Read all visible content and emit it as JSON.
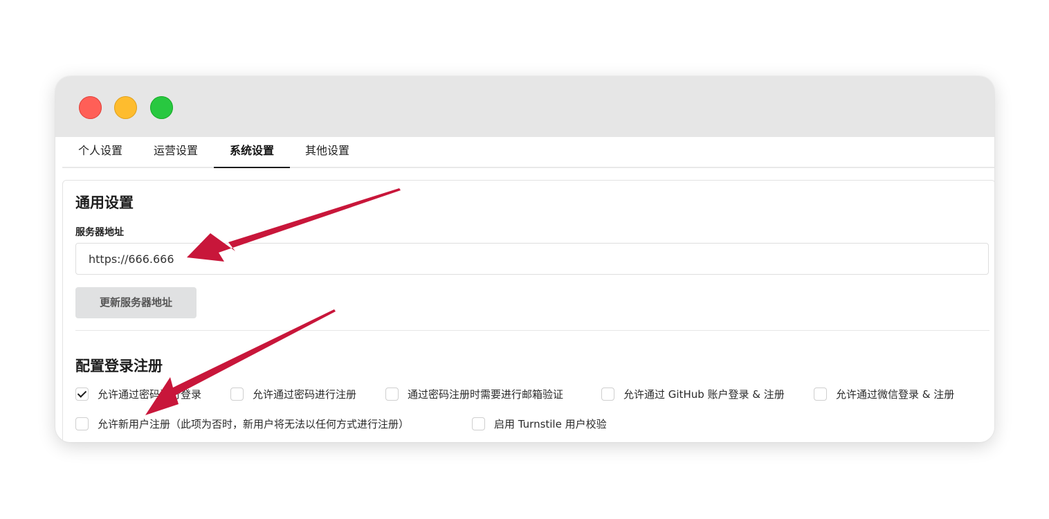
{
  "window": {
    "controls": [
      "close",
      "minimize",
      "maximize"
    ]
  },
  "tabs": [
    {
      "label": "个人设置",
      "active": false
    },
    {
      "label": "运营设置",
      "active": false
    },
    {
      "label": "系统设置",
      "active": true
    },
    {
      "label": "其他设置",
      "active": false
    }
  ],
  "general": {
    "title": "通用设置",
    "server_label": "服务器地址",
    "server_value": "https://666.666",
    "update_button": "更新服务器地址"
  },
  "login": {
    "title": "配置登录注册",
    "options": [
      {
        "label": "允许通过密码进行登录",
        "checked": true
      },
      {
        "label": "允许通过密码进行注册",
        "checked": false
      },
      {
        "label": "通过密码注册时需要进行邮箱验证",
        "checked": false
      },
      {
        "label": "允许通过 GitHub 账户登录 & 注册",
        "checked": false
      },
      {
        "label": "允许通过微信登录 & 注册",
        "checked": false
      },
      {
        "label": "允许新用户注册（此项为否时，新用户将无法以任何方式进行注册）",
        "checked": false
      },
      {
        "label": "启用 Turnstile 用户校验",
        "checked": false
      }
    ]
  },
  "colors": {
    "annotation_arrow": "#c8163a"
  }
}
